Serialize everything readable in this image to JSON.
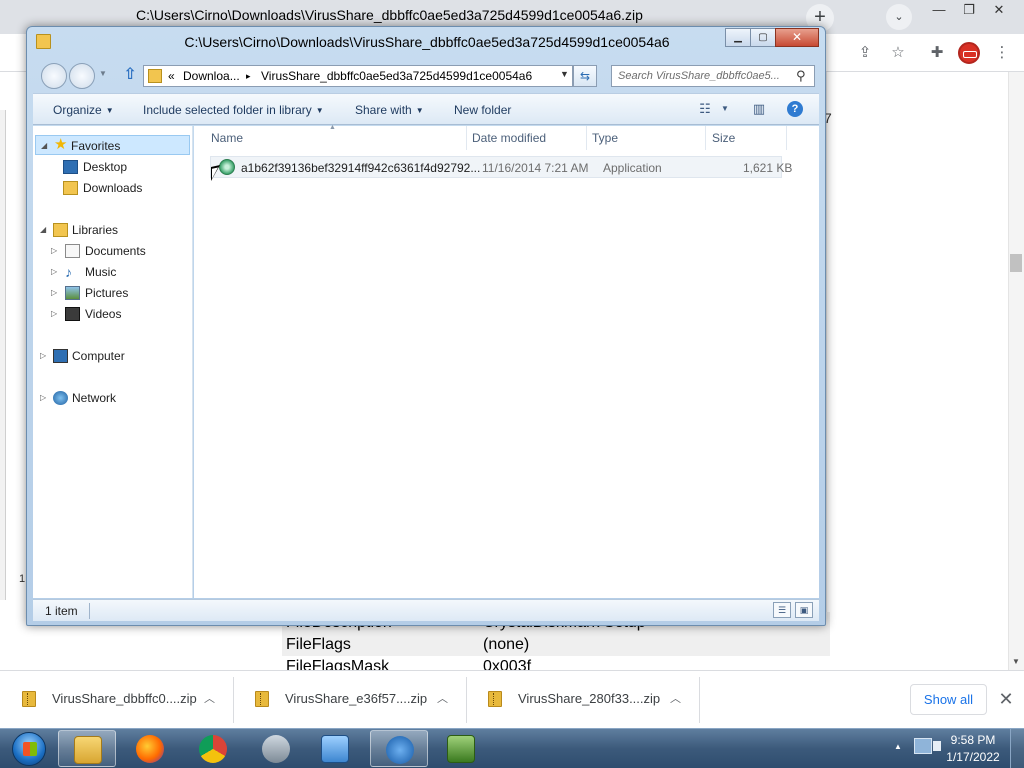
{
  "browser": {
    "window_title": "C:\\Users\\Cirno\\Downloads\\VirusShare_dbbffc0ae5ed3a725d4599d1ce0054a6.zip",
    "new_tab_glyph": "+",
    "page_rows": [
      {
        "key": "FileDescription",
        "value": "CrystalDiskMark Setup"
      },
      {
        "key": "FileFlags",
        "value": "(none)"
      },
      {
        "key": "FileFlagsMask",
        "value": "0x003f"
      }
    ],
    "behind_char_left": "1",
    "behind_char_right": "7"
  },
  "downloads": {
    "items": [
      {
        "name": "VirusShare_dbbffc0....zip"
      },
      {
        "name": "VirusShare_e36f57....zip"
      },
      {
        "name": "VirusShare_280f33....zip"
      }
    ],
    "show_all_label": "Show all"
  },
  "explorer": {
    "title": "C:\\Users\\Cirno\\Downloads\\VirusShare_dbbffc0ae5ed3a725d4599d1ce0054a6",
    "address": {
      "overflow": "«",
      "crumb_1": "Downloa...",
      "separator": "▸",
      "crumb_2": "VirusShare_dbbffc0ae5ed3a725d4599d1ce0054a6"
    },
    "search_placeholder": "Search VirusShare_dbbffc0ae5...",
    "commands": {
      "organize": "Organize",
      "include": "Include selected folder in library",
      "share": "Share with",
      "new_folder": "New folder"
    },
    "nav": {
      "favorites": "Favorites",
      "desktop": "Desktop",
      "downloads": "Downloads",
      "libraries": "Libraries",
      "documents": "Documents",
      "music": "Music",
      "pictures": "Pictures",
      "videos": "Videos",
      "computer": "Computer",
      "network": "Network"
    },
    "columns": {
      "name": "Name",
      "date": "Date modified",
      "type": "Type",
      "size": "Size"
    },
    "files": [
      {
        "name": "a1b62f39136bef32914ff942c6361f4d92792...",
        "date": "11/16/2014 7:21 AM",
        "type": "Application",
        "size": "1,621 KB"
      }
    ],
    "status": "1 item"
  },
  "taskbar": {
    "time": "9:58 PM",
    "date": "1/17/2022"
  },
  "colors": {
    "taskbar": "#3c5a7b",
    "chrome_tabstrip": "#dee1e6",
    "explorer_frame": "#b4cde7",
    "link_blue": "#1a73e8"
  }
}
